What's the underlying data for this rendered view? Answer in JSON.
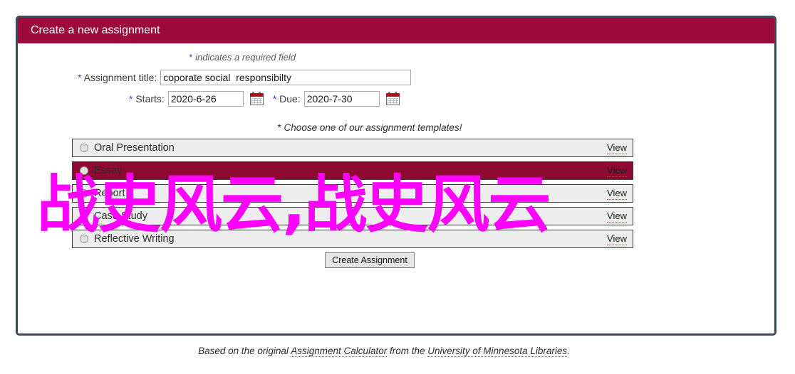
{
  "panel": {
    "header_title": "Create a new assignment",
    "header_color": "#9d0a3c",
    "border_color": "#3c4a5a"
  },
  "required_note": {
    "star": "*",
    "text": " indicates a required field"
  },
  "form": {
    "title_field": {
      "star": "*",
      "label": " Assignment title:",
      "value": "coporate social  responsibilty",
      "placeholder": ""
    },
    "starts_field": {
      "star": "*",
      "label": " Starts:",
      "value": "2020-6-26",
      "placeholder": "",
      "calendar_icon": "calendar-icon"
    },
    "due_field": {
      "star": "*",
      "label": " Due:",
      "value": "2020-7-30",
      "placeholder": "",
      "calendar_icon": "calendar-icon"
    }
  },
  "templates": {
    "instruction_star": "*",
    "instruction": " Choose one of our assignment templates!",
    "view_label": "View",
    "selected_index": 1,
    "selected_color": "#8f0a33",
    "rows": [
      {
        "label": "Oral Presentation",
        "view": "View",
        "selected": false
      },
      {
        "label": "Essay",
        "view": "View",
        "selected": true
      },
      {
        "label": "Report",
        "view": "View",
        "selected": false
      },
      {
        "label": "Case Study",
        "view": "View",
        "selected": false
      },
      {
        "label": "Reflective Writing",
        "view": "View",
        "selected": false
      }
    ]
  },
  "submit": {
    "label": "Create Assignment"
  },
  "footer": {
    "before": "Based on the original ",
    "link1": "Assignment Calculator",
    "middle": " from the ",
    "link2": "University of Minnesota Libraries",
    "after": "."
  },
  "overlay": {
    "text": "战史风云,战史风云",
    "color": "#ff00ff"
  }
}
